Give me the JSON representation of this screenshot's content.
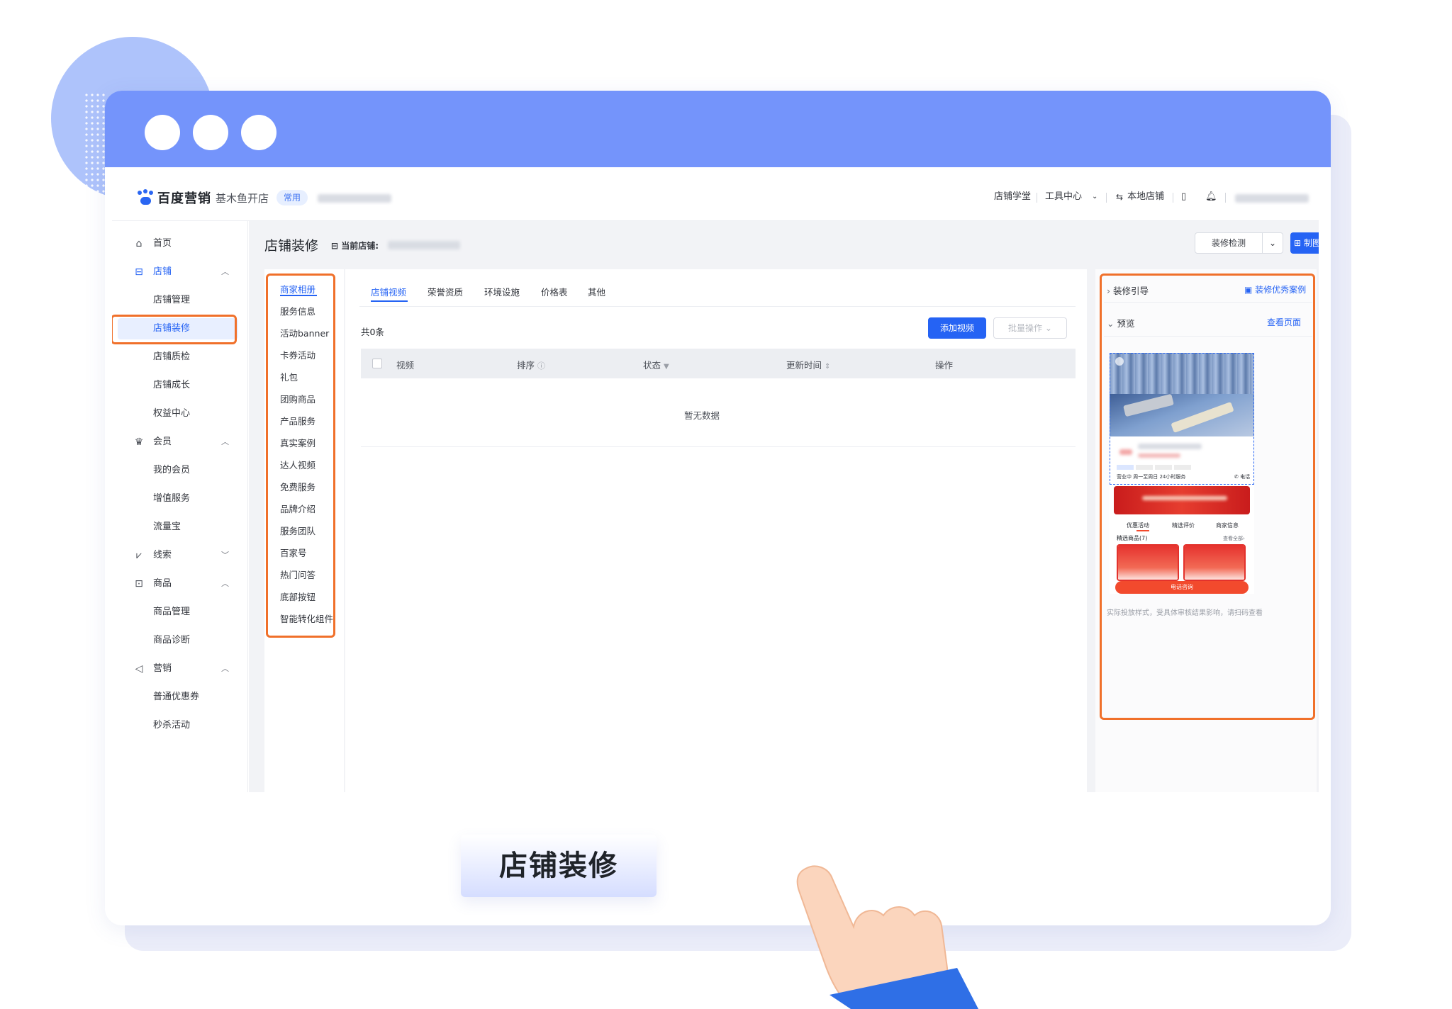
{
  "topbar": {
    "brand": "百度营销",
    "product": "基木鱼开店",
    "tag": "常用",
    "links": [
      "店铺学堂",
      "工具中心",
      "本地店铺"
    ]
  },
  "sidebar": {
    "items": [
      {
        "label": "首页",
        "icon": "home-icon"
      },
      {
        "label": "店铺",
        "icon": "store-icon"
      },
      {
        "label": "店铺管理"
      },
      {
        "label": "店铺装修"
      },
      {
        "label": "店铺质检"
      },
      {
        "label": "店铺成长"
      },
      {
        "label": "权益中心"
      },
      {
        "label": "会员",
        "icon": "crown-icon"
      },
      {
        "label": "我的会员"
      },
      {
        "label": "增值服务"
      },
      {
        "label": "流量宝"
      },
      {
        "label": "线索",
        "icon": "chart-icon"
      },
      {
        "label": "商品",
        "icon": "goods-icon"
      },
      {
        "label": "商品管理"
      },
      {
        "label": "商品诊断"
      },
      {
        "label": "营销",
        "icon": "megaphone-icon"
      },
      {
        "label": "普通优惠券"
      },
      {
        "label": "秒杀活动"
      }
    ]
  },
  "page": {
    "title": "店铺装修",
    "current_store_label": "当前店铺:",
    "check_button": "装修检测",
    "make_button": "制图工"
  },
  "categories": [
    "商家相册",
    "服务信息",
    "活动banner",
    "卡券活动",
    "礼包",
    "团购商品",
    "产品服务",
    "真实案例",
    "达人视频",
    "免费服务",
    "品牌介绍",
    "服务团队",
    "百家号",
    "热门问答",
    "底部按钮",
    "智能转化组件"
  ],
  "tabs": [
    "店铺视频",
    "荣誉资质",
    "环境设施",
    "价格表",
    "其他"
  ],
  "table": {
    "count": "共0条",
    "add_button": "添加视频",
    "batch_button": "批量操作",
    "columns": [
      "视频",
      "排序",
      "状态",
      "更新时间",
      "操作"
    ],
    "empty": "暂无数据"
  },
  "preview": {
    "guide": "装修引导",
    "cases_link": "装修优秀案例",
    "preview": "预览",
    "view_page": "查看页面",
    "tabs": [
      "优惠活动",
      "精选评价",
      "商家信息"
    ],
    "goods_title": "精选商品(7)",
    "view_all": "查看全部",
    "call": "电话咨询",
    "hint": "实际投放样式，受具体审核结果影响，请扫码查看",
    "status_line": "营业中  周一至周日 24小时服务",
    "phone_label": "电话"
  },
  "caption": "店铺装修",
  "colors": {
    "window_bar": "#7494fb",
    "accent": "#2563f4",
    "highlight": "#f0702a"
  }
}
